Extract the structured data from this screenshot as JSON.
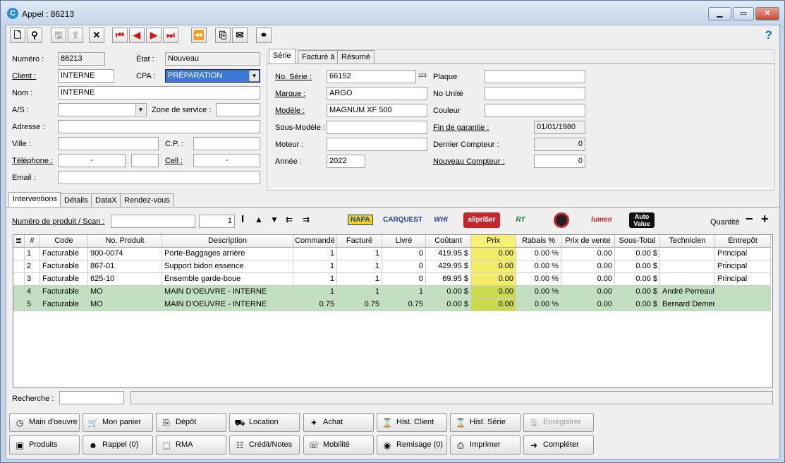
{
  "window": {
    "title": "Appel : 86213",
    "app_icon": "C"
  },
  "toolbar": {
    "help_label": "?"
  },
  "header": {
    "numero_label": "Numéro :",
    "numero": "86213",
    "etat_label": "État :",
    "etat": "Nouveau",
    "client_label": "Client :",
    "client": "INTERNE",
    "cpa_label": "CPA :",
    "cpa": "PRÉPARATION",
    "nom_label": "Nom :",
    "nom": "INTERNE",
    "as_label": "A/S :",
    "as": "",
    "zone_label": "Zone de service :",
    "zone": "",
    "adresse_label": "Adresse :",
    "adresse": "",
    "ville_label": "Ville :",
    "ville": "",
    "cp_label": "C.P. :",
    "cp": "",
    "telephone_label": "Téléphone :",
    "telephone": "-",
    "telephone_ext": "",
    "cell_label": "Cell :",
    "cell": "-",
    "email_label": "Email :",
    "email": ""
  },
  "serie_tabs": [
    "Série",
    "Facturé à",
    "Résumé"
  ],
  "serie": {
    "no_serie_label": "No. Série :",
    "no_serie": "66152",
    "no_serie_badge": "123",
    "marque_label": "Marque :",
    "marque": "ARGO",
    "modele_label": "Modèle :",
    "modele": "MAGNUM XF 500",
    "sous_modele_label": "Sous-Modèle :",
    "sous_modele": "",
    "moteur_label": "Moteur :",
    "moteur": "",
    "annee_label": "Année :",
    "annee": "2022",
    "plaque_label": "Plaque",
    "plaque": "",
    "no_unite_label": "No Unité",
    "no_unite": "",
    "couleur_label": "Couleur",
    "couleur": "",
    "fin_garantie_label": "Fin de garantie :",
    "fin_garantie": "01/01/1980",
    "dernier_compteur_label": "Dernier Compteur :",
    "dernier_compteur": "0",
    "nouveau_compteur_label": "Nouveau Compteur :",
    "nouveau_compteur": "0"
  },
  "lower_tabs": [
    "Interventions",
    "Détails",
    "DataX",
    "Rendez-vous"
  ],
  "scan": {
    "label": "Numéro de produit / Scan :",
    "value": "",
    "qty": "1",
    "quantite_label": "Quantité"
  },
  "suppliers": [
    {
      "name": "NAPA",
      "color": "#1d3f97",
      "bg": "#f4d21a"
    },
    {
      "name": "CARQUEST",
      "color": "#1d3f97",
      "bg": "#ffffff"
    },
    {
      "name": "WHI",
      "color": "#2a3f9a",
      "bg": "#ffffff"
    },
    {
      "name": "allpri$er",
      "color": "#ffffff",
      "bg": "#c8262d"
    },
    {
      "name": "RT",
      "color": "#0f7c3a",
      "bg": "#ffffff"
    },
    {
      "name": "",
      "color": "#c8262d",
      "bg": "#222222"
    },
    {
      "name": "lumen",
      "color": "#c8262d",
      "bg": "#ffffff"
    },
    {
      "name": "Auto Value",
      "color": "#ffffff",
      "bg": "#111111"
    }
  ],
  "grid": {
    "columns": [
      "",
      "#",
      "Code",
      "No. Produit",
      "Description",
      "Commandé",
      "Facturé",
      "Livré",
      "Coûtant",
      "Prix",
      "Rabais %",
      "Prix de vente",
      "Sous-Total",
      "Technicien",
      "Entrepôt"
    ],
    "rows": [
      [
        "",
        "1",
        "Facturable",
        "900-0074",
        "Porte-Baggages arrière",
        "1",
        "1",
        "0",
        "419.95 $",
        "0.00",
        "0.00 %",
        "0.00",
        "0.00 $",
        "",
        "Principal"
      ],
      [
        "",
        "2",
        "Facturable",
        "867-01",
        "Support bidon essence",
        "1",
        "1",
        "0",
        "429.95 $",
        "0.00",
        "0.00 %",
        "0.00",
        "0.00 $",
        "",
        "Principal"
      ],
      [
        "",
        "3",
        "Facturable",
        "625-10",
        "Ensemble garde-boue",
        "1",
        "1",
        "0",
        "69.95 $",
        "0.00",
        "0.00 %",
        "0.00",
        "0.00 $",
        "",
        "Principal"
      ],
      [
        "",
        "4",
        "Facturable",
        "MO",
        "MAIN D'OEUVRE - INTERNE",
        "1",
        "1",
        "1",
        "0.00 $",
        "0.00",
        "0.00 %",
        "0.00",
        "0.00 $",
        "André Perreault",
        ""
      ],
      [
        "",
        "5",
        "Facturable",
        "MO",
        "MAIN D'OEUVRE - INTERNE",
        "0.75",
        "0.75",
        "0.75",
        "0.00 $",
        "0.00",
        "0.00 %",
        "0.00",
        "0.00 $",
        "Bernard Demers",
        ""
      ]
    ]
  },
  "recherche": {
    "label": "Recherche :",
    "value": ""
  },
  "buttons_row1": [
    {
      "label": "Main d'oeuvre",
      "icon": "clock-icon",
      "glyph": "◷",
      "enabled": true
    },
    {
      "label": "Mon panier",
      "icon": "cart-icon",
      "glyph": "🛒",
      "enabled": true
    },
    {
      "label": "Dépôt",
      "icon": "deposit-icon",
      "glyph": "⎘",
      "enabled": true
    },
    {
      "label": "Location",
      "icon": "location-icon",
      "glyph": "⛟",
      "enabled": true
    },
    {
      "label": "Achat",
      "icon": "purchase-icon",
      "glyph": "✦",
      "enabled": true
    },
    {
      "label": "Hist. Client",
      "icon": "history-client-icon",
      "glyph": "⌛",
      "enabled": true
    },
    {
      "label": "Hist. Série",
      "icon": "history-serie-icon",
      "glyph": "⌛",
      "enabled": true
    },
    {
      "label": "Enregistrer",
      "icon": "save-icon",
      "glyph": "🖫",
      "enabled": false
    }
  ],
  "buttons_row2": [
    {
      "label": "Produits",
      "icon": "box-icon",
      "glyph": "▣",
      "enabled": true
    },
    {
      "label": "Rappel (0)",
      "icon": "person-icon",
      "glyph": "☻",
      "enabled": true
    },
    {
      "label": "RMA",
      "icon": "rma-icon",
      "glyph": "⬚",
      "enabled": true
    },
    {
      "label": "Crédit/Notes",
      "icon": "credit-notes-icon",
      "glyph": "☷",
      "enabled": true
    },
    {
      "label": "Mobilité",
      "icon": "mobile-icon",
      "glyph": "☏",
      "enabled": true
    },
    {
      "label": "Remisage (0)",
      "icon": "storage-icon",
      "glyph": "◉",
      "enabled": true
    },
    {
      "label": "Imprimer",
      "icon": "printer-icon",
      "glyph": "⎙",
      "enabled": true
    },
    {
      "label": "Compléter",
      "icon": "complete-icon",
      "glyph": "➜",
      "enabled": true
    }
  ]
}
